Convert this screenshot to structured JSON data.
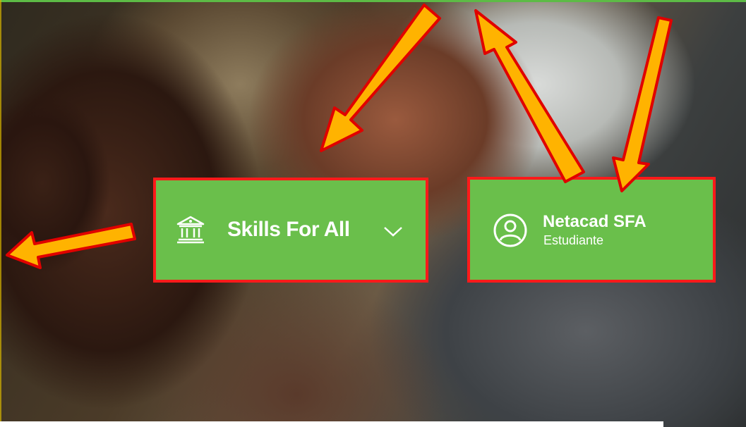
{
  "institution_menu": {
    "label": "Skills For All",
    "icon": "institution-icon",
    "chevron": "chevron-down-icon"
  },
  "user_menu": {
    "name": "Netacad SFA",
    "role": "Estudiante",
    "icon": "user-circle-icon"
  },
  "annotation_colors": {
    "frame": "#ff1a1a",
    "arrow_fill": "#ffb300",
    "arrow_outline": "#e00000",
    "panel": "#6abf4b"
  }
}
